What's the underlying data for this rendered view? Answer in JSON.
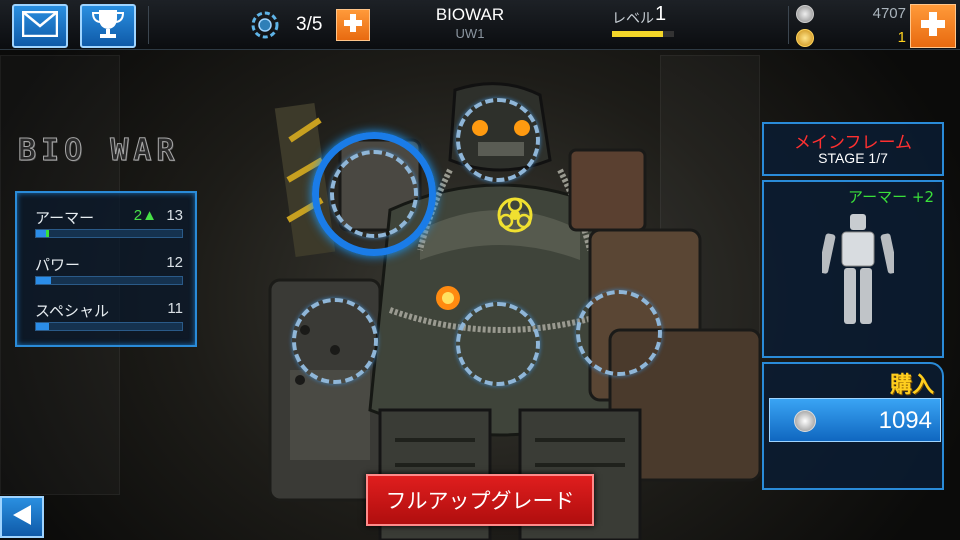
{
  "topbar": {
    "energy_count": "3/5",
    "mode_title": "BIOWAR",
    "mode_subtitle": "UW1",
    "level_label": "レベル",
    "level_value": "1",
    "level_progress": 0.82,
    "silver_value": "4707",
    "gold_value": "1"
  },
  "logo": "BIO WAR",
  "stats": [
    {
      "name": "アーマー",
      "bonus": "2▲",
      "value": "13",
      "fill": 0.07,
      "extra": 0.02
    },
    {
      "name": "パワー",
      "bonus": "",
      "value": "12",
      "fill": 0.1,
      "extra": 0
    },
    {
      "name": "スペシャル",
      "bonus": "",
      "value": "11",
      "fill": 0.09,
      "extra": 0
    }
  ],
  "part": {
    "title": "メインフレーム",
    "stage": "STAGE 1/7",
    "bonus": "アーマー +2",
    "buy_label": "購入",
    "price": "1094"
  },
  "actions": {
    "full_upgrade": "フルアップグレード"
  },
  "colors": {
    "accent_blue": "#2a8bd8",
    "upgrade_red": "#d01818",
    "buy_gold": "#ffce1e",
    "bonus_green": "#3ae03a"
  }
}
